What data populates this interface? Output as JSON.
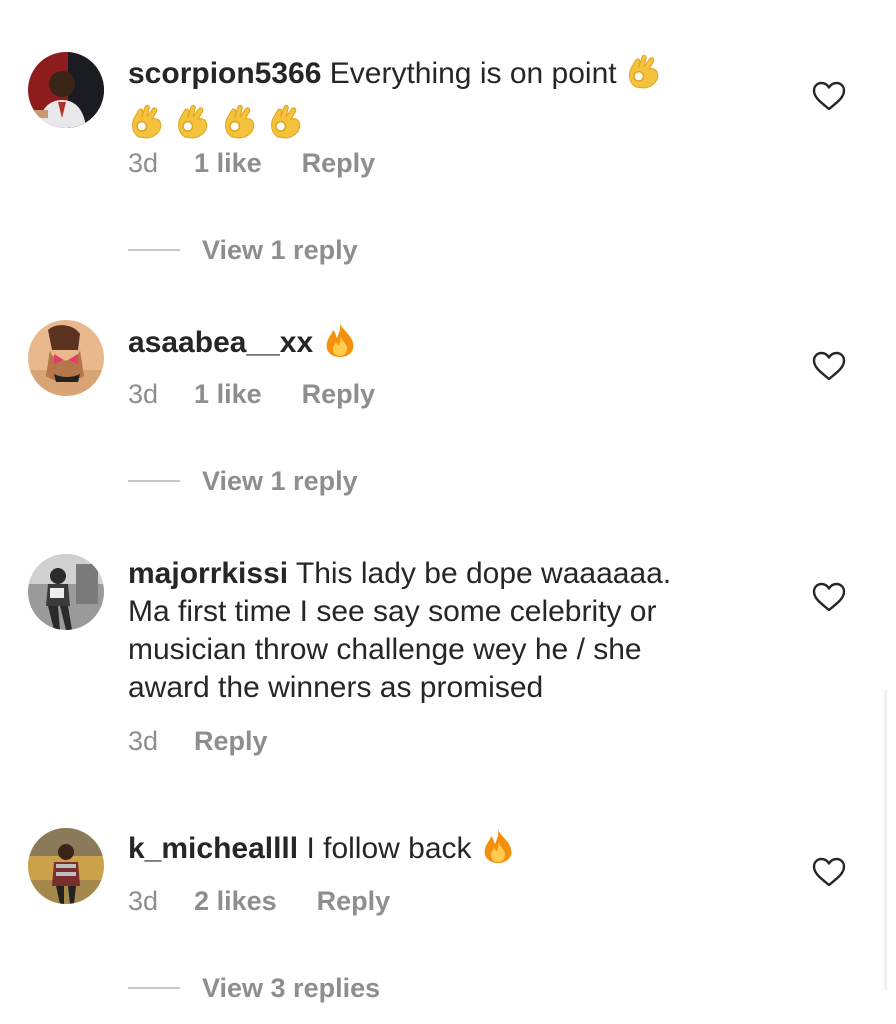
{
  "comments": [
    {
      "username": "scorpion5366",
      "text": " Everything is on point ",
      "emoji": "ok-hand-emoji",
      "emoji_line2_count": 4,
      "time": "3d",
      "likes": "1 like",
      "reply": "Reply",
      "view_replies": "View 1 reply"
    },
    {
      "username": "asaabea__xx",
      "text": " ",
      "emoji": "fire-emoji",
      "time": "3d",
      "likes": "1 like",
      "reply": "Reply",
      "view_replies": "View 1 reply"
    },
    {
      "username": "majorrkissi",
      "text_lines": [
        " This lady be dope waaaaaa.",
        "Ma first time I see say some celebrity or",
        "musician throw challenge wey he / she",
        "award the winners as promised"
      ],
      "time": "3d",
      "reply": "Reply"
    },
    {
      "username": "k_micheallll",
      "text": " I follow back ",
      "emoji": "fire-emoji",
      "time": "3d",
      "likes": "2 likes",
      "reply": "Reply",
      "view_replies": "View 3 replies"
    }
  ],
  "colors": {
    "text": "#262626",
    "secondary": "#8e8e8e",
    "divider": "#c7c7c7",
    "ok_hand": "#f5c23d",
    "fire_outer": "#f4900c",
    "fire_inner": "#ffcc4d"
  },
  "icons": {
    "like": "heart-outline-icon"
  }
}
